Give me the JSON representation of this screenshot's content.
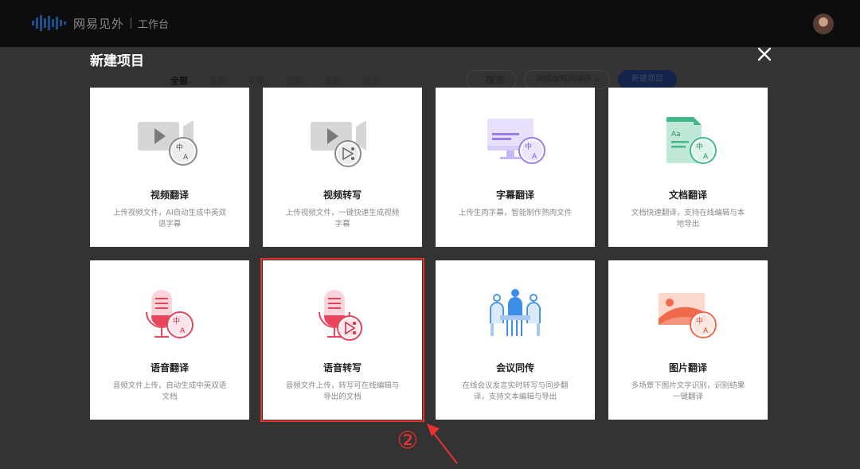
{
  "topbar": {
    "brand": "网易见外",
    "workspace": "工作台"
  },
  "background": {
    "filters": [
      "全部",
      "视频",
      "字幕",
      "音频",
      "文档",
      "会议"
    ],
    "search": "搜索",
    "sort": "按修改时间排序",
    "new_project": "新建项目"
  },
  "modal": {
    "title": "新建项目",
    "cards": [
      {
        "title": "视频翻译",
        "desc": "上传视频文件，AI自动生成中英双语字幕",
        "icon": "video-translate-icon"
      },
      {
        "title": "视频转写",
        "desc": "上传视频文件，一键快速生成视频字幕",
        "icon": "video-transcribe-icon"
      },
      {
        "title": "字幕翻译",
        "desc": "上传生肉字幕，智能制作熟肉文件",
        "icon": "subtitle-translate-icon"
      },
      {
        "title": "文档翻译",
        "desc": "文档快速翻译，支持在线编辑与本地导出",
        "icon": "document-translate-icon"
      },
      {
        "title": "语音翻译",
        "desc": "音频文件上传，自动生成中英双语文档",
        "icon": "audio-translate-icon"
      },
      {
        "title": "语音转写",
        "desc": "音频文件上传，转写可在线编辑与导出的文档",
        "icon": "audio-transcribe-icon"
      },
      {
        "title": "会议同传",
        "desc": "在线会议发言实时转写与同步翻译，支持文本编辑与导出",
        "icon": "meeting-interpret-icon"
      },
      {
        "title": "图片翻译",
        "desc": "多场景下图片文字识别，识别结果一键翻译",
        "icon": "image-translate-icon"
      }
    ],
    "selected_index": 5
  },
  "annotation": {
    "step": "②",
    "color": "#e8322f"
  },
  "colors": {
    "gray_icon": "#b9b9b9",
    "purple_icon": "#9a7de8",
    "green_icon": "#43b98a",
    "red_icon": "#e8455a",
    "blue_icon": "#3a8ee8",
    "orange_icon": "#f06a4a"
  },
  "icon_badge_chars": [
    "中",
    "A"
  ]
}
